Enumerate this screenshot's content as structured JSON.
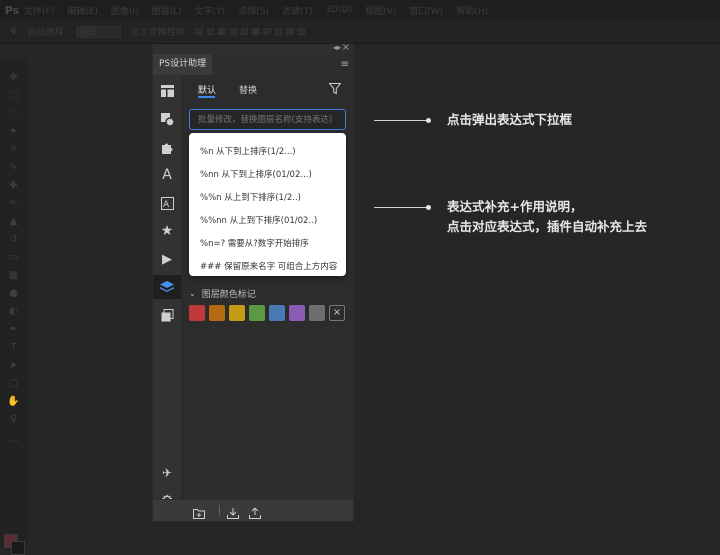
{
  "app": {
    "logo": "Ps",
    "menu": [
      "文件(F)",
      "编辑(E)",
      "图像(I)",
      "图层(L)",
      "文字(Y)",
      "选择(S)",
      "滤镜(T)",
      "3D(D)",
      "视图(V)",
      "窗口(W)",
      "帮助(H)"
    ],
    "options": {
      "auto_select": "自动选择:",
      "auto_select_value": "图层",
      "transform": "显示变换控件"
    }
  },
  "panel": {
    "title": "PS设计助理",
    "tabs": {
      "default": "默认",
      "replace": "替换"
    },
    "search": {
      "placeholder": "批量修改，替换图层名称(支持表达)",
      "value": ""
    },
    "dropdown": [
      "%n 从下到上排序(1/2...)",
      "%nn 从下到上排序(01/02...)",
      "%%n 从上到下排序(1/2..)",
      "%%nn 从上到下排序(01/02..)",
      "%n=? 需要从?数字开始排序",
      "### 保留原来名字 可组合上方内容"
    ],
    "color_section": {
      "title": "图层颜色标记",
      "colors": [
        "#c0393d",
        "#b86a12",
        "#c39b14",
        "#5a9a42",
        "#4b79b5",
        "#8a5bb2",
        "#6e6e6e"
      ]
    }
  },
  "annotations": {
    "first": "点击弹出表达式下拉框",
    "second_line1": "表达式补充+作用说明，",
    "second_line2": "点击对应表达式，插件自动补充上去"
  },
  "colors": {
    "accent": "#3d7fe0",
    "panel_bg": "#2c2c2c"
  }
}
